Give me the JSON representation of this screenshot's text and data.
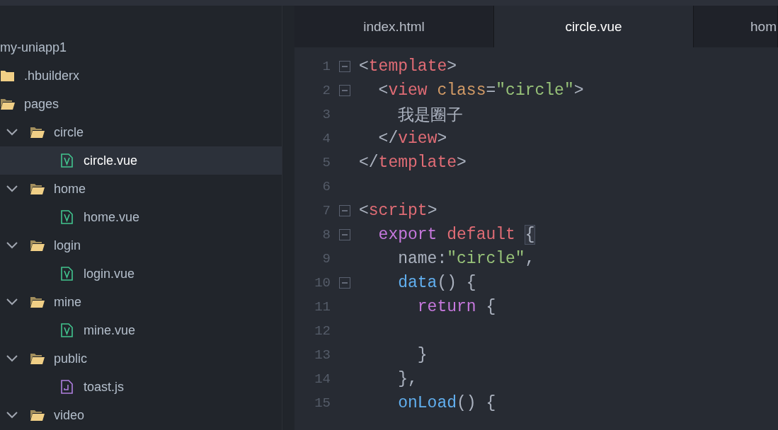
{
  "sidebar": {
    "tree": [
      {
        "label": "my-uniapp1",
        "selected": false,
        "children": [
          {
            "label": ".hbuilderx",
            "kind": "folder",
            "expanded": false,
            "selected": false
          },
          {
            "label": "pages",
            "kind": "folder",
            "expanded": true,
            "selected": false,
            "children": [
              {
                "label": "circle",
                "kind": "folder",
                "expanded": true,
                "selected": false,
                "children": [
                  {
                    "label": "circle.vue",
                    "kind": "vue",
                    "selected": true
                  }
                ]
              },
              {
                "label": "home",
                "kind": "folder",
                "expanded": true,
                "selected": false,
                "children": [
                  {
                    "label": "home.vue",
                    "kind": "vue",
                    "selected": false
                  }
                ]
              },
              {
                "label": "login",
                "kind": "folder",
                "expanded": true,
                "selected": false,
                "children": [
                  {
                    "label": "login.vue",
                    "kind": "vue",
                    "selected": false
                  }
                ]
              },
              {
                "label": "mine",
                "kind": "folder",
                "expanded": true,
                "selected": false,
                "children": [
                  {
                    "label": "mine.vue",
                    "kind": "vue",
                    "selected": false
                  }
                ]
              },
              {
                "label": "public",
                "kind": "folder",
                "expanded": true,
                "selected": false,
                "children": [
                  {
                    "label": "toast.js",
                    "kind": "js",
                    "selected": false
                  }
                ]
              },
              {
                "label": "video",
                "kind": "folder",
                "expanded": true,
                "selected": false
              }
            ]
          }
        ]
      }
    ]
  },
  "tabs": [
    {
      "label": "index.html",
      "selected": false
    },
    {
      "label": "circle.vue",
      "selected": true
    },
    {
      "label": "hom",
      "selected": false
    }
  ],
  "editor": {
    "lines": [
      {
        "number": "1",
        "fold": true,
        "tokens": [
          {
            "kind": "punct",
            "text": "<"
          },
          {
            "kind": "tag",
            "text": "template"
          },
          {
            "kind": "punct",
            "text": ">"
          }
        ]
      },
      {
        "number": "2",
        "fold": true,
        "tokens": [
          {
            "kind": "punct",
            "text": "  <"
          },
          {
            "kind": "tag",
            "text": "view"
          },
          {
            "kind": "attr",
            "text": " class"
          },
          {
            "kind": "punct",
            "text": "="
          },
          {
            "kind": "string",
            "text": "\"circle\""
          },
          {
            "kind": "punct",
            "text": ">"
          }
        ]
      },
      {
        "number": "3",
        "fold": false,
        "tokens": [
          {
            "kind": "plain",
            "text": "    我是圈子"
          }
        ]
      },
      {
        "number": "4",
        "fold": false,
        "tokens": [
          {
            "kind": "punct",
            "text": "  </"
          },
          {
            "kind": "tag",
            "text": "view"
          },
          {
            "kind": "punct",
            "text": ">"
          }
        ]
      },
      {
        "number": "5",
        "fold": false,
        "tokens": [
          {
            "kind": "punct",
            "text": "</"
          },
          {
            "kind": "tag",
            "text": "template"
          },
          {
            "kind": "punct",
            "text": ">"
          }
        ]
      },
      {
        "number": "6",
        "fold": false
      },
      {
        "number": "7",
        "fold": true,
        "tokens": [
          {
            "kind": "punct",
            "text": "<"
          },
          {
            "kind": "tag",
            "text": "script"
          },
          {
            "kind": "punct",
            "text": ">"
          }
        ]
      },
      {
        "number": "8",
        "fold": true,
        "tokens": [
          {
            "kind": "keyword",
            "text": "  export"
          },
          {
            "kind": "tag",
            "text": " default "
          },
          {
            "kind": "plain",
            "text": "{",
            "highlight": true
          }
        ]
      },
      {
        "number": "9",
        "fold": false,
        "tokens": [
          {
            "kind": "plain",
            "text": "    name:"
          },
          {
            "kind": "string",
            "text": "\"circle\""
          },
          {
            "kind": "plain",
            "text": ","
          }
        ]
      },
      {
        "number": "10",
        "fold": true,
        "tokens": [
          {
            "kind": "func",
            "text": "    data"
          },
          {
            "kind": "plain",
            "text": "() {"
          }
        ]
      },
      {
        "number": "11",
        "fold": false,
        "tokens": [
          {
            "kind": "keyword",
            "text": "      return"
          },
          {
            "kind": "plain",
            "text": " {"
          }
        ]
      },
      {
        "number": "12",
        "fold": false
      },
      {
        "number": "13",
        "fold": false,
        "tokens": [
          {
            "kind": "plain",
            "text": "      }"
          }
        ]
      },
      {
        "number": "14",
        "fold": false,
        "tokens": [
          {
            "kind": "plain",
            "text": "    },"
          }
        ]
      },
      {
        "number": "15",
        "fold": false,
        "tokens": [
          {
            "kind": "func",
            "text": "    onLoad"
          },
          {
            "kind": "plain",
            "text": "() {"
          }
        ]
      }
    ]
  }
}
